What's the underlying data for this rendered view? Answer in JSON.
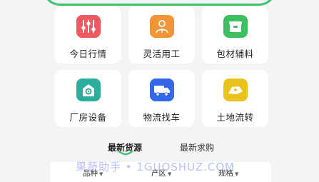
{
  "grid": {
    "items": [
      {
        "label": "今日行情",
        "icon": "sliders-icon",
        "color": "#f0595f"
      },
      {
        "label": "灵活用工",
        "icon": "worker-icon",
        "color": "#f39437"
      },
      {
        "label": "包材辅料",
        "icon": "package-icon",
        "color": "#3cbf5f"
      },
      {
        "label": "厂房设备",
        "icon": "factory-gear-icon",
        "color": "#2cae9c"
      },
      {
        "label": "物流找车",
        "icon": "truck-icon",
        "color": "#3468e8"
      },
      {
        "label": "土地流转",
        "icon": "land-icon",
        "color": "#e9c21c"
      }
    ]
  },
  "tabs": [
    {
      "label": "最新货源",
      "active": true
    },
    {
      "label": "最新求购",
      "active": false
    }
  ],
  "filters": [
    {
      "label": "品种"
    },
    {
      "label": "产区"
    },
    {
      "label": "规格"
    }
  ],
  "watermark": "果蔬助手 • 1GUOSHUZ.COM",
  "colors": {
    "accent_green": "#3fc06a",
    "page_bg": "#f3f4f6"
  }
}
